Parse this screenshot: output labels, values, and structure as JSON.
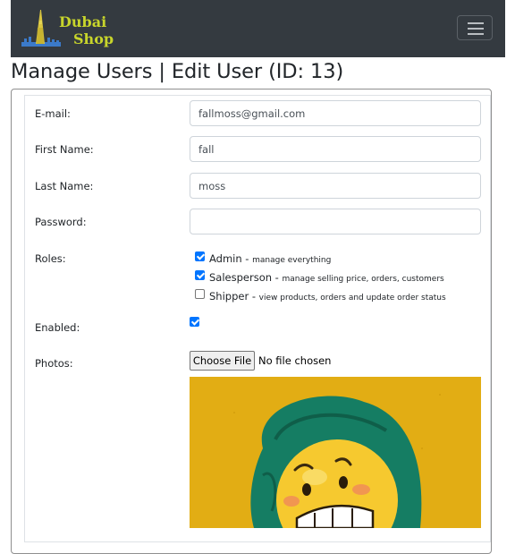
{
  "navbar": {
    "logo": {
      "line1": "Dubai",
      "line2": "Shop",
      "icon": "burj-khalifa-skyline-icon"
    },
    "toggler_icon": "hamburger-menu-icon"
  },
  "page": {
    "title": "Manage Users | Edit User (ID: 13)"
  },
  "form": {
    "email": {
      "label": "E-mail:",
      "value": "fallmoss@gmail.com"
    },
    "first_name": {
      "label": "First Name:",
      "value": "fall"
    },
    "last_name": {
      "label": "Last Name:",
      "value": "moss"
    },
    "password": {
      "label": "Password:",
      "value": ""
    },
    "roles": {
      "label": "Roles:",
      "items": [
        {
          "name": "Admin",
          "separator": " - ",
          "desc": "manage everything",
          "checked": true
        },
        {
          "name": "Salesperson",
          "separator": " - ",
          "desc": "manage selling price, orders, customers",
          "checked": true
        },
        {
          "name": "Shipper",
          "separator": " - ",
          "desc": "view products, orders and update order status",
          "checked": false
        }
      ]
    },
    "enabled": {
      "label": "Enabled:",
      "checked": true
    },
    "photos": {
      "label": "Photos:",
      "button_label": "Choose File",
      "status": "No file chosen"
    }
  },
  "colors": {
    "navbar_bg": "#343a40",
    "logo_text": "#c8d52b",
    "checkbox": "#0075ff",
    "photo_bg": "#e2ad14",
    "hood": "#157d63",
    "emoji": "#f6c92f"
  }
}
